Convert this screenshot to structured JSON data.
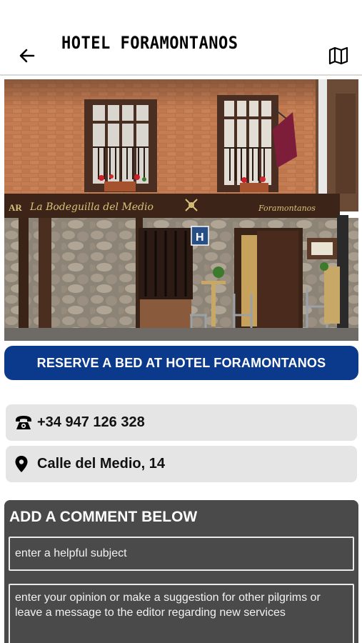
{
  "header": {
    "title": "HOTEL FORAMONTANOS",
    "back_icon": "arrow-left-icon",
    "map_icon": "map-icon"
  },
  "photo": {
    "sign_bar_left": "AR",
    "sign_bodeguilla": "La Bodeguilla del Medio",
    "sign_hotel": "Foramontanos",
    "hotel_plaque": "H"
  },
  "reserve": {
    "label": "RESERVE A BED AT HOTEL FORAMONTANOS"
  },
  "contact": {
    "phone": "+34 947 126 328",
    "phone_icon": "telephone-icon",
    "address": "Calle del Medio, 14",
    "address_icon": "map-pin-icon"
  },
  "comment": {
    "title": "ADD A COMMENT BELOW",
    "subject_placeholder": "enter a helpful subject",
    "opinion_placeholder": "enter your opinion or make a suggestion for other pilgrims or leave a message to the editor regarding new services"
  },
  "colors": {
    "accent": "#0b3a8c",
    "panel": "#4a4a4a",
    "info_bg": "#e5e5e5"
  }
}
